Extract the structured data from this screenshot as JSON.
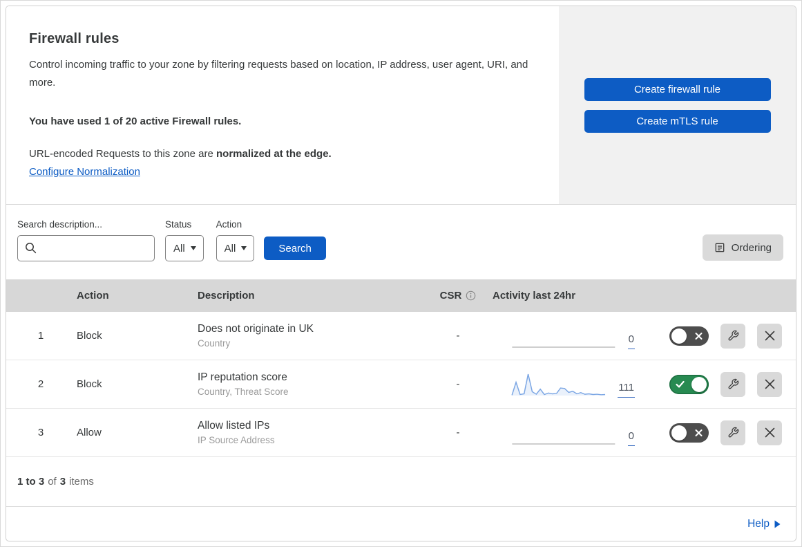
{
  "panel": {
    "title": "Firewall rules",
    "description": "Control incoming traffic to your zone by filtering requests based on location, IP address, user agent, URI, and more.",
    "usage_note": "You have used 1 of 20 active Firewall rules.",
    "normalization_text": "URL-encoded Requests to this zone are",
    "normalization_bold": "normalized at the edge.",
    "normalization_link": "Configure Normalization",
    "create_firewall_button": "Create firewall rule",
    "create_mtls_button": "Create mTLS rule"
  },
  "filters": {
    "search_label": "Search description...",
    "status_label": "Status",
    "status_value": "All",
    "action_label": "Action",
    "action_value": "All",
    "search_button": "Search",
    "ordering_button": "Ordering"
  },
  "table": {
    "headers": {
      "action": "Action",
      "description": "Description",
      "csr": "CSR",
      "activity": "Activity last 24hr"
    },
    "rows": [
      {
        "index": "1",
        "action": "Block",
        "description": "Does not originate in UK",
        "fields": "Country",
        "csr": "-",
        "activity_count": "0",
        "enabled": false,
        "sparkline": []
      },
      {
        "index": "2",
        "action": "Block",
        "description": "IP reputation score",
        "fields": "Country, Threat Score",
        "csr": "-",
        "activity_count": "111",
        "enabled": true,
        "sparkline": [
          2,
          62,
          5,
          8,
          100,
          18,
          6,
          30,
          5,
          12,
          8,
          10,
          35,
          33,
          15,
          20,
          8,
          14,
          6,
          8,
          5,
          6,
          4,
          5
        ]
      },
      {
        "index": "3",
        "action": "Allow",
        "description": "Allow listed IPs",
        "fields": "IP Source Address",
        "csr": "-",
        "activity_count": "0",
        "enabled": false,
        "sparkline": []
      }
    ]
  },
  "footer": {
    "range_text": "1 to 3",
    "of_label": "of",
    "total": "3",
    "items_label": "items",
    "help_label": "Help"
  },
  "icons": {
    "search": "magnifier",
    "dropdown_caret": "triangle-down",
    "ordering": "list-document",
    "csr_info": "info-circle",
    "wrench": "wrench",
    "remove": "x-mark",
    "toggle_on_mark": "check",
    "toggle_off_mark": "x-mark",
    "help_arrow": "right-triangle"
  },
  "colors": {
    "accent": "#0d5cc4",
    "toggle_on": "#278a51",
    "toggle_off": "#4d4d4d",
    "spark_line": "#7ba6e4",
    "spark_fill": "#eaf1fb"
  }
}
